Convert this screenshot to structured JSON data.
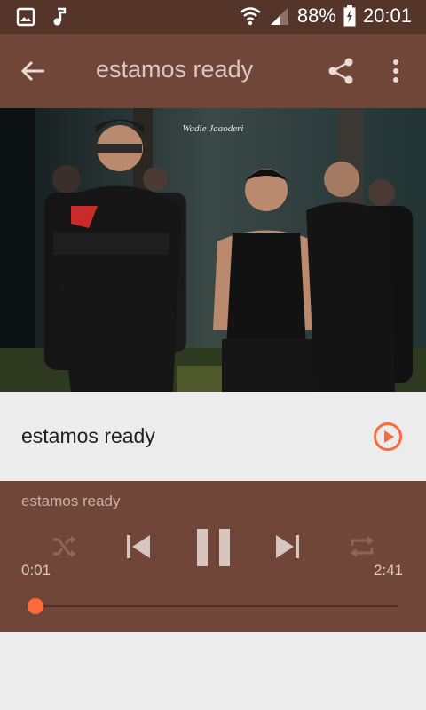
{
  "status_bar": {
    "battery": "88%",
    "time": "20:01"
  },
  "app_bar": {
    "title": "estamos ready"
  },
  "track_list": [
    {
      "title": "estamos ready"
    }
  ],
  "player": {
    "now_playing": "estamos ready",
    "elapsed": "0:01",
    "duration": "2:41",
    "progress": 0.006
  },
  "colors": {
    "status_bar": "#55342a",
    "app_bar": "#6f4638",
    "accent": "#ff6a3a",
    "background": "#ececec"
  },
  "icons": [
    "image-icon",
    "music-note-icon",
    "wifi-icon",
    "signal-icon",
    "battery-charging-icon",
    "back-arrow-icon",
    "share-icon",
    "more-vert-icon",
    "play-circle-icon",
    "shuffle-icon",
    "skip-previous-icon",
    "pause-icon",
    "skip-next-icon",
    "repeat-icon"
  ]
}
